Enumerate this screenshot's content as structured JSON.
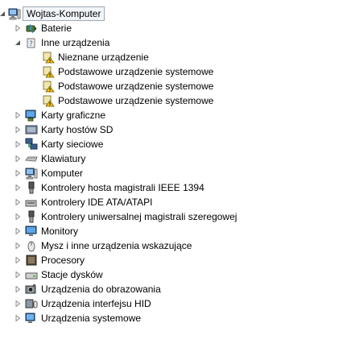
{
  "root": {
    "label": "Wojtas-Komputer",
    "icon": "computer-icon",
    "expanded": true
  },
  "categories": [
    {
      "label": "Baterie",
      "icon": "battery-icon",
      "expanded": false
    },
    {
      "label": "Inne urządzenia",
      "icon": "unknown-device-icon",
      "expanded": true,
      "children": [
        {
          "label": "Nieznane urządzenie",
          "icon": "warning-device-icon"
        },
        {
          "label": "Podstawowe urządzenie systemowe",
          "icon": "warning-device-icon"
        },
        {
          "label": "Podstawowe urządzenie systemowe",
          "icon": "warning-device-icon"
        },
        {
          "label": "Podstawowe urządzenie systemowe",
          "icon": "warning-device-icon"
        }
      ]
    },
    {
      "label": "Karty graficzne",
      "icon": "display-adapter-icon",
      "expanded": false
    },
    {
      "label": "Karty hostów SD",
      "icon": "sd-host-icon",
      "expanded": false
    },
    {
      "label": "Karty sieciowe",
      "icon": "network-adapter-icon",
      "expanded": false
    },
    {
      "label": "Klawiatury",
      "icon": "keyboard-icon",
      "expanded": false
    },
    {
      "label": "Komputer",
      "icon": "computer-icon",
      "expanded": false
    },
    {
      "label": "Kontrolery hosta magistrali IEEE 1394",
      "icon": "ieee1394-icon",
      "expanded": false
    },
    {
      "label": "Kontrolery IDE ATA/ATAPI",
      "icon": "ide-controller-icon",
      "expanded": false
    },
    {
      "label": "Kontrolery uniwersalnej magistrali szeregowej",
      "icon": "usb-icon",
      "expanded": false
    },
    {
      "label": "Monitory",
      "icon": "monitor-icon",
      "expanded": false
    },
    {
      "label": "Mysz i inne urządzenia wskazujące",
      "icon": "mouse-icon",
      "expanded": false
    },
    {
      "label": "Procesory",
      "icon": "processor-icon",
      "expanded": false
    },
    {
      "label": "Stacje dysków",
      "icon": "disk-drive-icon",
      "expanded": false
    },
    {
      "label": "Urządzenia do obrazowania",
      "icon": "imaging-device-icon",
      "expanded": false
    },
    {
      "label": "Urządzenia interfejsu HID",
      "icon": "hid-icon",
      "expanded": false
    },
    {
      "label": "Urządzenia systemowe",
      "icon": "system-device-icon",
      "expanded": false
    }
  ],
  "colors": {
    "expander": "#8c8c8c",
    "selection_border": "#9ea7b1",
    "selection_bg": "#f2f6fb",
    "warning": "#f2c200"
  }
}
